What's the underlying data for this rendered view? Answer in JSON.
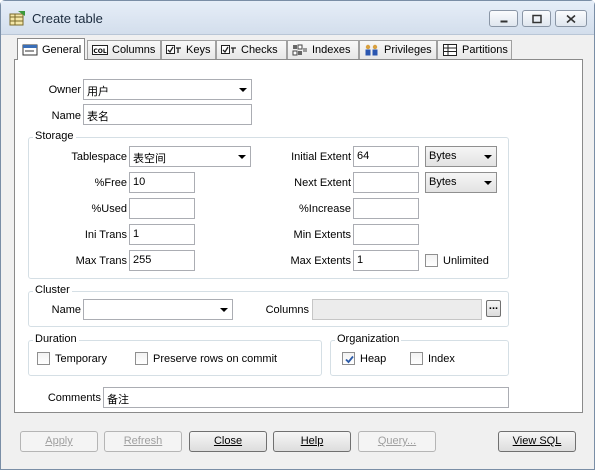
{
  "window": {
    "title": "Create table"
  },
  "tabs": [
    {
      "label": "General",
      "icon": "general-tab-icon",
      "active": true
    },
    {
      "label": "Columns",
      "icon": "columns-tab-icon"
    },
    {
      "label": "Keys",
      "icon": "keys-tab-icon"
    },
    {
      "label": "Checks",
      "icon": "checks-tab-icon"
    },
    {
      "label": "Indexes",
      "icon": "indexes-tab-icon"
    },
    {
      "label": "Privileges",
      "icon": "privileges-tab-icon"
    },
    {
      "label": "Partitions",
      "icon": "partitions-tab-icon"
    }
  ],
  "general": {
    "owner_label": "Owner",
    "owner_value": "用户",
    "name_label": "Name",
    "name_value": "表名"
  },
  "storage": {
    "title": "Storage",
    "tablespace_label": "Tablespace",
    "tablespace_value": "表空间",
    "free_label": "%Free",
    "free_value": "10",
    "used_label": "%Used",
    "used_value": "",
    "initrans_label": "Ini Trans",
    "initrans_value": "1",
    "maxtrans_label": "Max Trans",
    "maxtrans_value": "255",
    "initial_extent_label": "Initial Extent",
    "initial_extent_value": "64",
    "initial_extent_unit": "Bytes",
    "next_extent_label": "Next Extent",
    "next_extent_value": "",
    "next_extent_unit": "Bytes",
    "increase_label": "%Increase",
    "increase_value": "",
    "min_extents_label": "Min Extents",
    "min_extents_value": "",
    "max_extents_label": "Max Extents",
    "max_extents_value": "1",
    "unlimited_label": "Unlimited",
    "unlimited_checked": false
  },
  "cluster": {
    "title": "Cluster",
    "name_label": "Name",
    "name_value": "",
    "columns_label": "Columns",
    "columns_value": "",
    "browse_label": "..."
  },
  "duration": {
    "title": "Duration",
    "temporary_label": "Temporary",
    "temporary_checked": false,
    "preserve_label": "Preserve rows on commit",
    "preserve_checked": false
  },
  "organization": {
    "title": "Organization",
    "heap_label": "Heap",
    "heap_checked": true,
    "index_label": "Index",
    "index_checked": false
  },
  "comments": {
    "label": "Comments",
    "value": "备注"
  },
  "buttons": {
    "apply": "Apply",
    "refresh": "Refresh",
    "close": "Close",
    "help": "Help",
    "query": "Query...",
    "view_sql": "View SQL"
  },
  "colors": {
    "titlebar": "#dfe7f2",
    "check_mark": "#2b5aa8",
    "disabled_text": "#a0a0a0"
  }
}
